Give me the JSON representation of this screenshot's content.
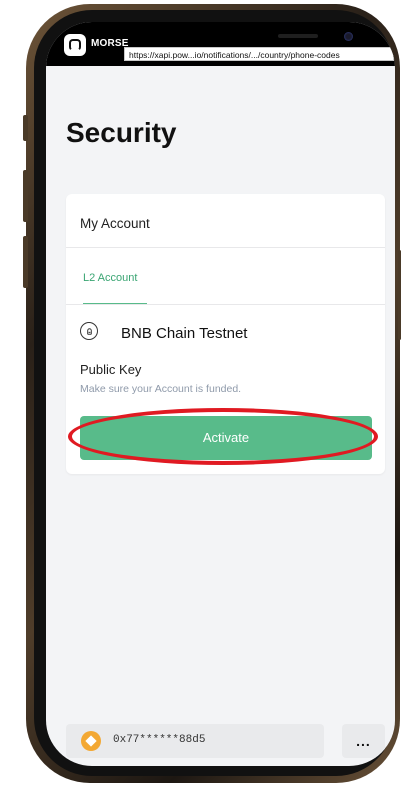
{
  "status_bar": {
    "brand": "MORSE",
    "url_tooltip": "https://xapi.pow...io/notifications/.../country/phone-codes"
  },
  "page": {
    "title": "Security"
  },
  "card": {
    "header": "My Account",
    "tab_label": "L2 Account",
    "chain_name": "BNB Chain Testnet",
    "public_key_label": "Public Key",
    "public_key_hint": "Make sure your Account is funded.",
    "activate_label": "Activate"
  },
  "wallet": {
    "address": "0x77******88d5",
    "more_label": "..."
  },
  "icons": {
    "brand_logo": "morse-logo-icon",
    "chain": "chain-icon",
    "coin": "bnb-coin-icon",
    "more": "more-icon"
  },
  "colors": {
    "accent": "#58bb8a",
    "tab_text": "#3aa573",
    "hint_text": "#8f9aaa",
    "annotation": "#e01a22"
  }
}
